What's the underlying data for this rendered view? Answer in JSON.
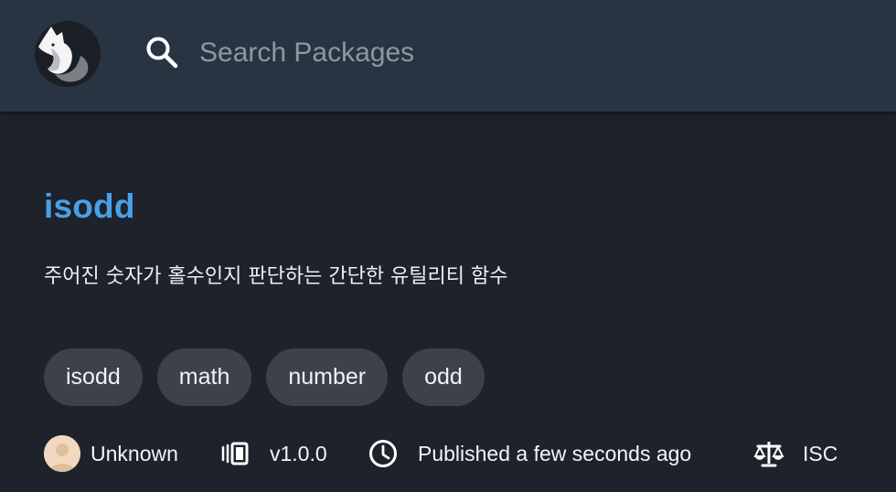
{
  "search": {
    "placeholder": "Search Packages",
    "value": ""
  },
  "package": {
    "name": "isodd",
    "description": "주어진 숫자가 홀수인지 판단하는 간단한 유틸리티 함수",
    "tags": [
      "isodd",
      "math",
      "number",
      "odd"
    ],
    "author": "Unknown",
    "version": "v1.0.0",
    "published": "Published a few seconds ago",
    "license": "ISC"
  },
  "colors": {
    "background": "#1e222b",
    "header": "#283442",
    "title_link": "#4aa0e6",
    "tag_background": "#3d414c"
  },
  "icons": {
    "logo": "fox-logo-icon",
    "search": "search-icon",
    "version": "version-icon",
    "time": "clock-icon",
    "license": "scale-icon"
  }
}
